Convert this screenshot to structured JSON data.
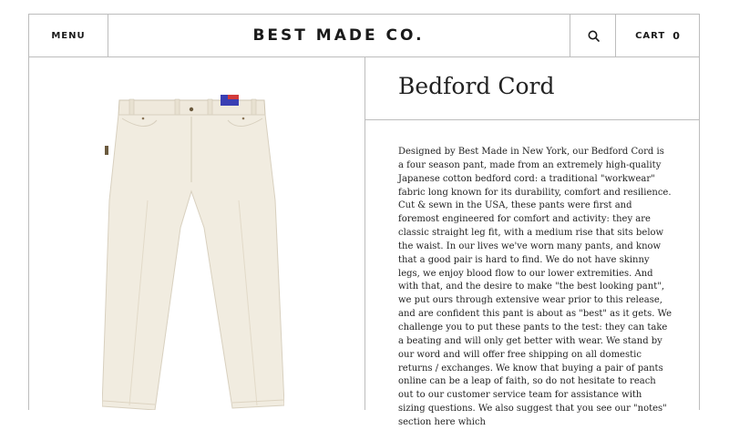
{
  "header": {
    "menu_label": "MENU",
    "brand": "BEST MADE CO.",
    "search_icon": "search-icon",
    "cart_label": "CART",
    "cart_count": "0"
  },
  "product": {
    "name": "Bedford Cord",
    "image": "cream-pants-image",
    "description": "Designed by Best Made in New York, our Bedford Cord is a four season pant, made from an extremely high-quality Japanese cotton bedford cord: a traditional \"workwear\" fabric long known for its durability, comfort and resilience. Cut & sewn in the USA, these pants were first and foremost engineered for comfort and activity: they are classic straight leg fit, with a medium rise that sits below the waist. In our lives we've worn many pants, and know that a good pair is hard to find. We do not have skinny legs, we enjoy blood flow to our lower extremities. And with that, and the desire to make \"the best looking pant\", we put ours through extensive wear prior to this release, and are confident this pant is about as \"best\" as it gets. We challenge you to put these pants to the test: they can take a beating and will only get better with wear. We stand by our word and will offer free shipping on all domestic returns / exchanges. We know that buying a pair of pants online can be a leap of faith, so do not hesitate to reach out to our customer service team for assistance with sizing questions. We also suggest that you see our \"notes\" section here which"
  },
  "colors": {
    "border": "#bdbdbd",
    "pant_fabric": "#f1ece0",
    "label_blue": "#3a3fb3",
    "label_red": "#d23a3a"
  }
}
